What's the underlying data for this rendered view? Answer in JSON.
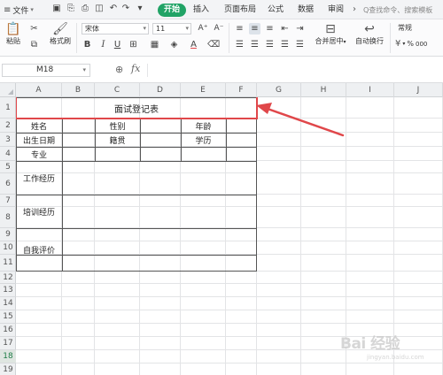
{
  "menubar": {
    "file_label": "文件",
    "start_label": "开始",
    "tabs": [
      "插入",
      "页面布局",
      "公式",
      "数据",
      "审阅"
    ],
    "search_placeholder": "Q查找命令、搜索模板"
  },
  "ribbon": {
    "paste_label": "粘贴",
    "format_painter_label": "格式刷",
    "font_name": "宋体",
    "font_size": "11",
    "merge_center_label": "合并居中",
    "wrap_text_label": "自动换行",
    "number_format": "常规",
    "bold": "B",
    "italic": "I",
    "underline": "U",
    "font_grow": "A⁺",
    "font_shrink": "A⁻",
    "font_color_letter": "A",
    "percent": "%",
    "thousands": "000"
  },
  "formulabar": {
    "name_box": "M18",
    "fx": "fx"
  },
  "columns": [
    "A",
    "B",
    "C",
    "D",
    "E",
    "F",
    "G",
    "H",
    "I",
    "J"
  ],
  "rows": [
    "1",
    "2",
    "3",
    "4",
    "5",
    "6",
    "7",
    "8",
    "9",
    "10",
    "11",
    "12",
    "13",
    "14",
    "15",
    "16",
    "17",
    "18",
    "19"
  ],
  "selected_row": "18",
  "form": {
    "title": "面试登记表",
    "name": "姓名",
    "gender": "性别",
    "age": "年龄",
    "birth_date": "出生日期",
    "native_place": "籍贯",
    "education": "学历",
    "major": "专业",
    "work_experience": "工作经历",
    "training_experience": "培训经历",
    "self_evaluation": "自我评价"
  },
  "watermark": {
    "text": "Bai 经验",
    "sub": "jingyan.baidu.com"
  },
  "colors": {
    "accent_green": "#21a366",
    "highlight_red": "#e0474a"
  }
}
